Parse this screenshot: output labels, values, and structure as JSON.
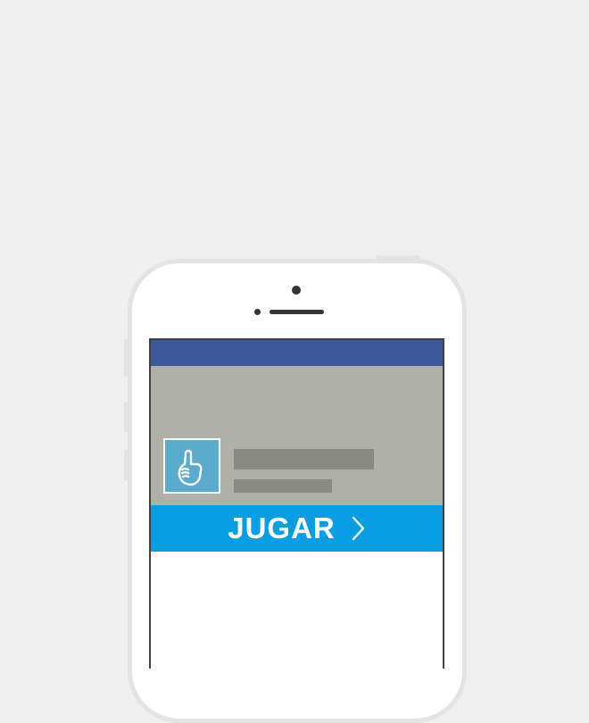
{
  "colors": {
    "background": "#efefef",
    "topbar": "#3b5998",
    "banner": "#b0b0ab",
    "app_icon": "#5aabcc",
    "play_button": "#079ee4",
    "placeholder": "#8a8a85"
  },
  "app_icon": {
    "icon": "foam-finger-icon"
  },
  "cta": {
    "label": "JUGAR",
    "icon": "chevron-right-icon"
  }
}
